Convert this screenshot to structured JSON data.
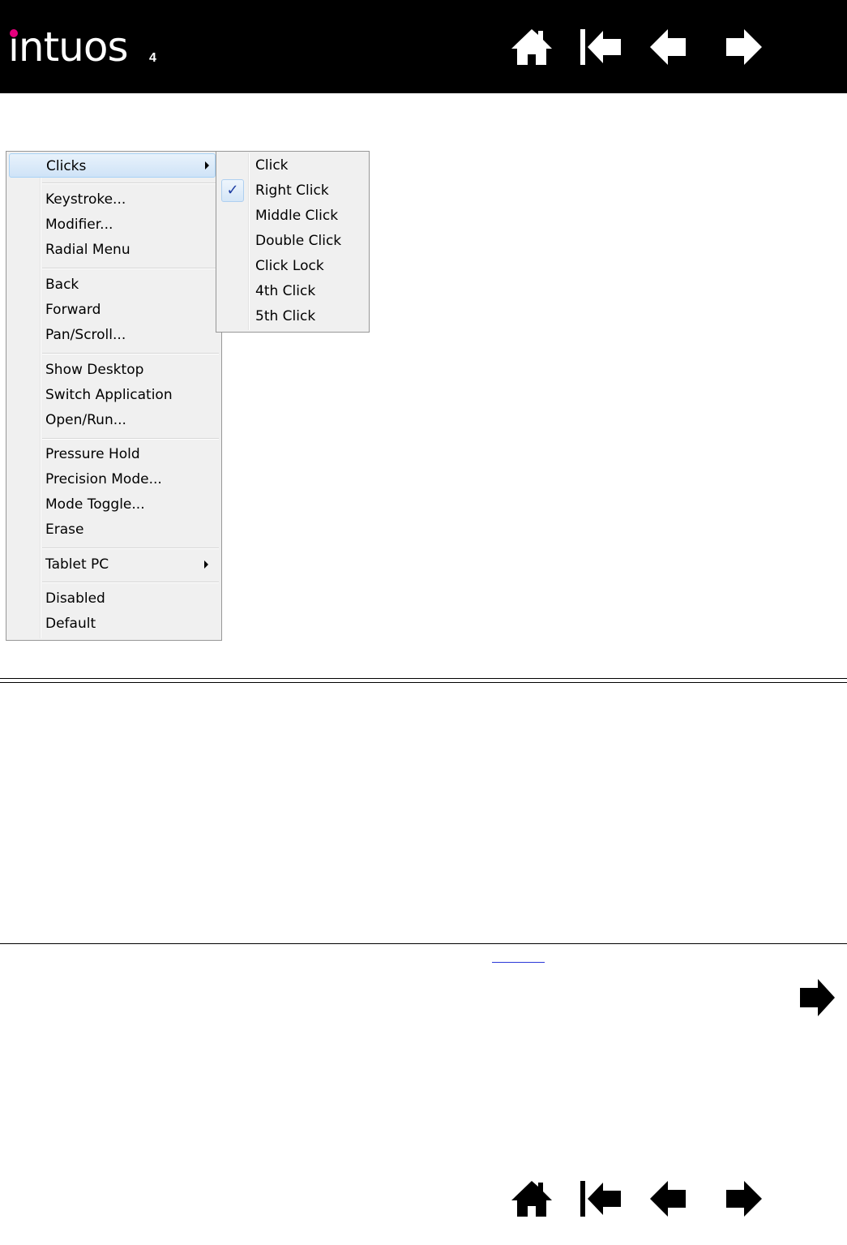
{
  "header": {
    "logo_text": "intuos",
    "logo_sub": "4",
    "accent_color": "#e6007e",
    "nav": [
      "home-icon",
      "first-page-icon",
      "previous-page-icon",
      "next-page-icon"
    ]
  },
  "main_menu": {
    "items": [
      {
        "label": "Clicks",
        "submenu": true,
        "highlighted": true
      },
      {
        "label": "Keystroke..."
      },
      {
        "label": "Modifier..."
      },
      {
        "label": "Radial Menu"
      },
      {
        "label": "Back"
      },
      {
        "label": "Forward"
      },
      {
        "label": "Pan/Scroll..."
      },
      {
        "label": "Show Desktop"
      },
      {
        "label": "Switch Application"
      },
      {
        "label": "Open/Run..."
      },
      {
        "label": "Pressure Hold"
      },
      {
        "label": "Precision Mode..."
      },
      {
        "label": "Mode Toggle..."
      },
      {
        "label": "Erase"
      },
      {
        "label": "Tablet PC",
        "submenu": true
      },
      {
        "label": "Disabled"
      },
      {
        "label": "Default"
      }
    ]
  },
  "sub_menu": {
    "items": [
      {
        "label": "Click"
      },
      {
        "label": "Right Click",
        "checked": true
      },
      {
        "label": "Middle Click"
      },
      {
        "label": "Double Click"
      },
      {
        "label": "Click Lock"
      },
      {
        "label": "4th Click"
      },
      {
        "label": "5th Click"
      }
    ],
    "check_glyph": "✓"
  },
  "footer": {
    "continue_icon": "next-arrow-icon"
  }
}
